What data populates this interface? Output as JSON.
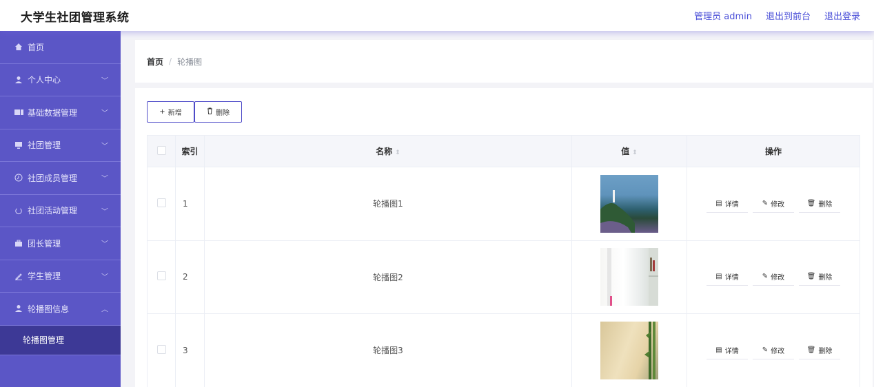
{
  "header": {
    "title": "大学生社团管理系统",
    "links": [
      "管理员 admin",
      "退出到前台",
      "退出登录"
    ]
  },
  "sidebar": {
    "items": [
      {
        "label": "首页",
        "icon": "home-icon"
      },
      {
        "label": "个人中心",
        "icon": "user-icon"
      },
      {
        "label": "基础数据管理",
        "icon": "ticket-icon"
      },
      {
        "label": "社团管理",
        "icon": "monitor-icon"
      },
      {
        "label": "社团成员管理",
        "icon": "clock-icon"
      },
      {
        "label": "社团活动管理",
        "icon": "power-icon"
      },
      {
        "label": "团长管理",
        "icon": "briefcase-icon"
      },
      {
        "label": "学生管理",
        "icon": "edit-icon"
      },
      {
        "label": "轮播图信息",
        "icon": "user-icon"
      }
    ],
    "active_sub": "轮播图管理"
  },
  "breadcrumb": {
    "home": "首页",
    "separator": "/",
    "current": "轮播图"
  },
  "toolbar": {
    "add_label": "新增",
    "delete_label": "删除"
  },
  "table": {
    "headers": {
      "index": "索引",
      "name": "名称",
      "value": "值",
      "actions": "操作"
    },
    "rows": [
      {
        "index": "1",
        "name": "轮播图1"
      },
      {
        "index": "2",
        "name": "轮播图2"
      },
      {
        "index": "3",
        "name": "轮播图3"
      }
    ],
    "actions": {
      "detail": "详情",
      "edit": "修改",
      "delete": "删除"
    }
  },
  "colors": {
    "sidebar_bg": "#5b56c6",
    "sidebar_active": "#3d3996",
    "accent": "#4a4fd8"
  }
}
